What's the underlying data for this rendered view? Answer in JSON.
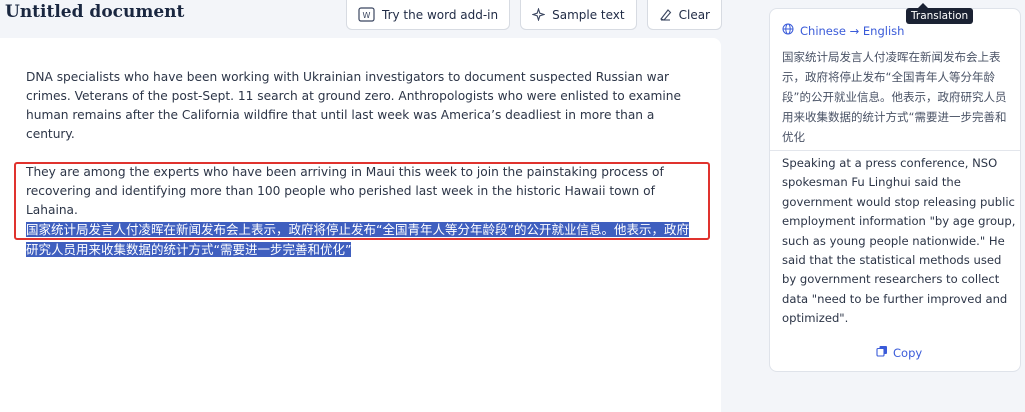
{
  "document": {
    "title": "Untitled document"
  },
  "toolbar": {
    "word_addin_label": "Try the word add-in",
    "sample_text_label": "Sample text",
    "clear_label": "Clear"
  },
  "editor": {
    "paragraph1": "DNA specialists who have been working with Ukrainian investigators to document suspected Russian war crimes. Veterans of the post-Sept. 11 search at ground zero. Anthropologists who were enlisted to examine human remains after the California wildfire that until last week was America’s deadliest in more than a century.",
    "paragraph2": "They are among the experts who have been arriving in Maui this week to join the painstaking process of recovering and identifying more than 100 people who perished last week in the historic Hawaii town of Lahaina.",
    "selected_text": "国家统计局发言人付凌晖在新闻发布会上表示，政府将停止发布“全国青年人等分年龄段”的公开就业信息。他表示，政府研究人员用来收集数据的统计方式“需要进一步完善和优化”"
  },
  "translation_panel": {
    "language_pair": "Chinese → English",
    "source_text": "国家统计局发言人付凌晖在新闻发布会上表示，政府将停止发布“全国青年人等分年龄段”的公开就业信息。他表示，政府研究人员用来收集数据的统计方式“需要进一步完善和优化",
    "translated_text": "Speaking at a press conference, NSO spokesman Fu Linghui said the government would stop releasing public employment information \"by age group, such as young people nationwide.\" He said that the statistical methods used by government researchers to collect data \"need to be further improved and optimized\".",
    "copy_label": "Copy",
    "tooltip": "Translation"
  },
  "colors": {
    "accent": "#3a5bd9",
    "selection": "#3f5fbf",
    "highlight_border": "#e0332e"
  },
  "icons": {
    "word_addin": "word-icon",
    "sample_text": "sparkle-icon",
    "clear": "eraser-icon",
    "language": "globe-icon",
    "copy": "copy-icon"
  }
}
